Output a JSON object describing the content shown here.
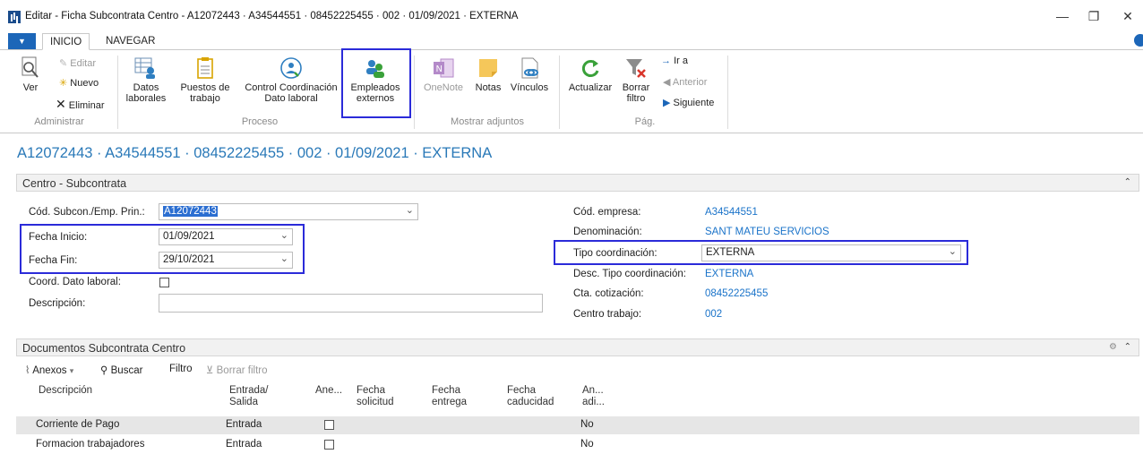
{
  "window": {
    "title": "Editar - Ficha Subcontrata Centro - A12072443 · A34544551 · 08452225455 · 002 · 01/09/2021 · EXTERNA",
    "minimize": "—",
    "restore": "❐",
    "close": "✕"
  },
  "ribbon": {
    "tabs": [
      {
        "label": "INICIO"
      },
      {
        "label": "NAVEGAR"
      }
    ],
    "groups": {
      "administrar": {
        "label": "Administrar",
        "ver": "Ver",
        "editar": "Editar",
        "nuevo": "Nuevo",
        "eliminar": "Eliminar"
      },
      "proceso": {
        "label": "Proceso",
        "datos_laborales": [
          "Datos",
          "laborales"
        ],
        "puestos_trabajo": [
          "Puestos de",
          "trabajo"
        ],
        "control_coordinacion": [
          "Control Coordinación",
          "Dato laboral"
        ],
        "empleados_externos": [
          "Empleados",
          "externos"
        ]
      },
      "adjuntos": {
        "label": "Mostrar adjuntos",
        "onenote": "OneNote",
        "notas": "Notas",
        "vinculos": "Vínculos"
      },
      "pag": {
        "label": "Pág.",
        "actualizar": "Actualizar",
        "borrar_filtro": [
          "Borrar",
          "filtro"
        ],
        "ir_a": "Ir a",
        "anterior": "Anterior",
        "siguiente": "Siguiente"
      }
    }
  },
  "record_title": "A12072443 · A34544551 · 08452225455 · 002 · 01/09/2021 · EXTERNA",
  "section_centro": {
    "title": "Centro - Subcontrata",
    "left": {
      "cod_subcon_label": "Cód. Subcon./Emp. Prin.:",
      "cod_subcon_value": "A12072443",
      "fecha_inicio_label": "Fecha Inicio:",
      "fecha_inicio_value": "01/09/2021",
      "fecha_fin_label": "Fecha Fin:",
      "fecha_fin_value": "29/10/2021",
      "coord_label": "Coord. Dato laboral:",
      "descripcion_label": "Descripción:",
      "descripcion_value": ""
    },
    "right": {
      "cod_empresa_label": "Cód. empresa:",
      "cod_empresa_value": "A34544551",
      "denominacion_label": "Denominación:",
      "denominacion_value": "SANT MATEU SERVICIOS",
      "tipo_coord_label": "Tipo coordinación:",
      "tipo_coord_value": "EXTERNA",
      "desc_tipo_label": "Desc. Tipo coordinación:",
      "desc_tipo_value": "EXTERNA",
      "cta_label": "Cta. cotización:",
      "cta_value": "08452225455",
      "centro_label": "Centro trabajo:",
      "centro_value": "002"
    }
  },
  "section_docs": {
    "title": "Documentos Subcontrata Centro",
    "toolbar": {
      "anexos": "Anexos",
      "buscar": "Buscar",
      "filtro": "Filtro",
      "borrar_filtro": "Borrar filtro"
    },
    "columns": [
      [
        "Descripción"
      ],
      [
        "Entrada/",
        "Salida"
      ],
      [
        "Ane..."
      ],
      [
        "Fecha",
        "solicitud"
      ],
      [
        "Fecha",
        "entrega"
      ],
      [
        "Fecha",
        "caducidad"
      ],
      [
        "An...",
        "adi..."
      ]
    ],
    "rows": [
      {
        "descripcion": "Corriente de Pago",
        "entrada_salida": "Entrada",
        "an_adi": "No"
      },
      {
        "descripcion": "Formacion trabajadores",
        "entrada_salida": "Entrada",
        "an_adi": "No"
      }
    ]
  },
  "colors": {
    "accent": "#1c66b8",
    "link": "#1a73c9",
    "highlight_box": "#2b2bd9"
  }
}
